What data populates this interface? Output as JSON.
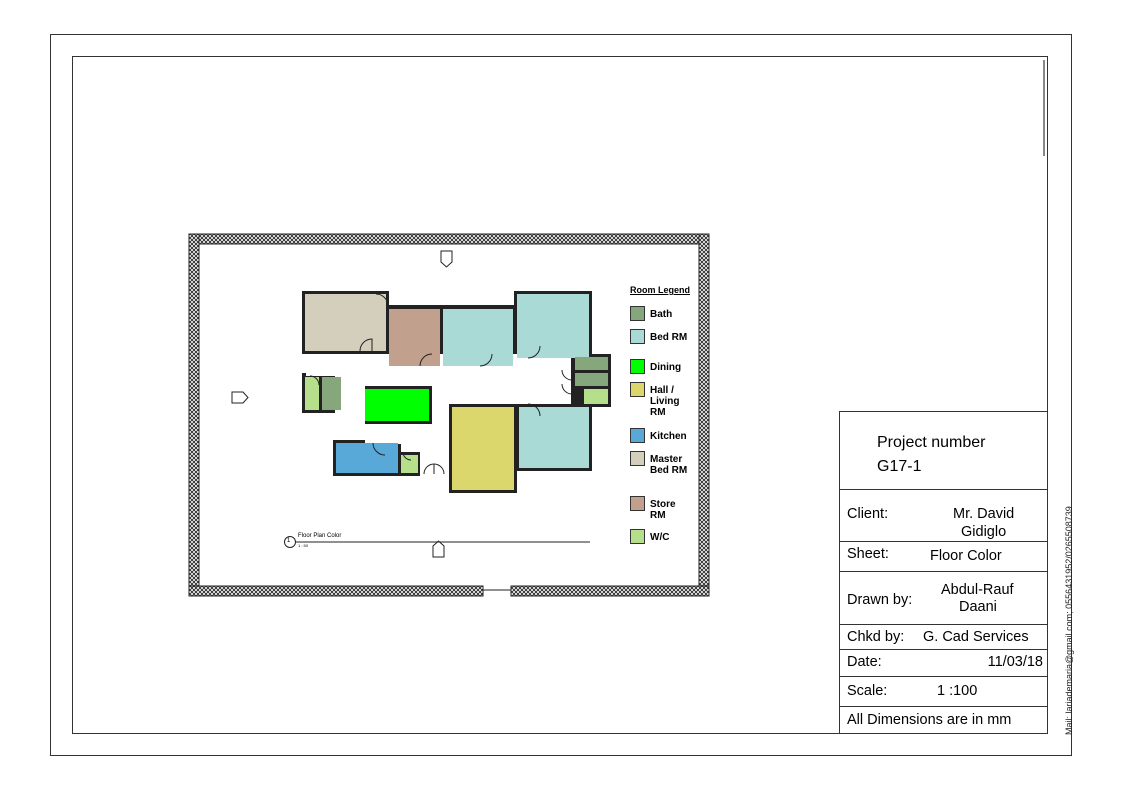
{
  "legend": {
    "title": "Room Legend",
    "items": [
      {
        "label": "Bath",
        "color": "#86a77c"
      },
      {
        "label": "Bed RM",
        "color": "#a9dad6"
      },
      {
        "label": "Dining",
        "color": "#00ff00"
      },
      {
        "label": "Hall / Living RM",
        "color": "#dbd76c"
      },
      {
        "label": "Kitchen",
        "color": "#58a9d8"
      },
      {
        "label": "Master Bed RM",
        "color": "#d4cebd"
      },
      {
        "label": "Store RM",
        "color": "#c1a08e"
      },
      {
        "label": "W/C",
        "color": "#b5df8b"
      }
    ]
  },
  "view_title": {
    "number": "1",
    "name": "Floor Plan Color",
    "scale": "1 : 50"
  },
  "title_block": {
    "project_number_label": "Project number",
    "project_number": "G17-1",
    "client_label": "Client:",
    "client_line1": "Mr. David",
    "client_line2": "Gidiglo",
    "sheet_label": "Sheet:",
    "sheet": "Floor Color",
    "drawn_label": "Drawn by:",
    "drawn_line1": "Abdul-Rauf",
    "drawn_line2": "Daani",
    "checked_label": "Chkd by:",
    "checked": "G. Cad Services",
    "date_label": "Date:",
    "date": "11/03/18",
    "scale_label": "Scale:",
    "scale": "1 :100",
    "note": "All Dimensions are in mm"
  },
  "contact": "Mail: lariademaria@gmail.com; 0556431952/0265508739",
  "elevation_marker_icon": "elevation-marker-icon"
}
